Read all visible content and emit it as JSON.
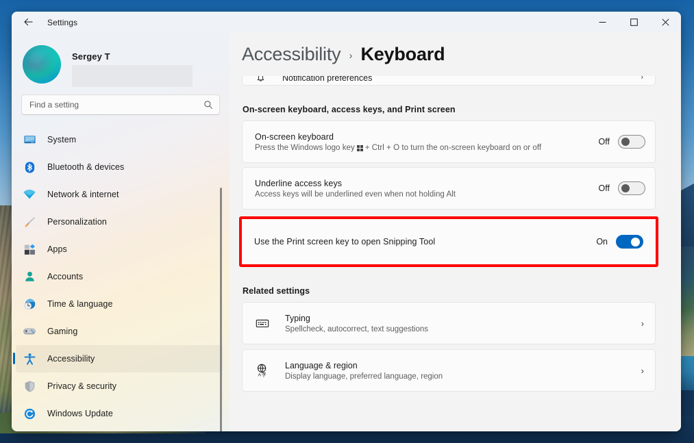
{
  "window": {
    "title": "Settings",
    "back_icon": "arrow-left-icon",
    "controls": {
      "minimize": "–",
      "maximize": "☐",
      "close": "✕"
    }
  },
  "account": {
    "name": "Sergey T",
    "email_redacted": ""
  },
  "search": {
    "placeholder": "Find a setting",
    "value": "",
    "icon": "search-icon"
  },
  "sidebar": {
    "items": [
      {
        "label": "System",
        "icon": "display-icon",
        "selected": false
      },
      {
        "label": "Bluetooth & devices",
        "icon": "bluetooth-icon",
        "selected": false
      },
      {
        "label": "Network & internet",
        "icon": "wifi-icon",
        "selected": false
      },
      {
        "label": "Personalization",
        "icon": "paintbrush-icon",
        "selected": false
      },
      {
        "label": "Apps",
        "icon": "apps-icon",
        "selected": false
      },
      {
        "label": "Accounts",
        "icon": "person-icon",
        "selected": false
      },
      {
        "label": "Time & language",
        "icon": "clock-globe-icon",
        "selected": false
      },
      {
        "label": "Gaming",
        "icon": "gamepad-icon",
        "selected": false
      },
      {
        "label": "Accessibility",
        "icon": "accessibility-icon",
        "selected": true
      },
      {
        "label": "Privacy & security",
        "icon": "shield-icon",
        "selected": false
      },
      {
        "label": "Windows Update",
        "icon": "update-icon",
        "selected": false
      }
    ]
  },
  "header": {
    "breadcrumb_parent": "Accessibility",
    "breadcrumb_separator": "›",
    "breadcrumb_current": "Keyboard"
  },
  "main": {
    "clipped_card": {
      "label": "Notification preferences",
      "icon": "bell-icon",
      "chevron": "›"
    },
    "section_heading": "On-screen keyboard, access keys, and Print screen",
    "settings": [
      {
        "title": "On-screen keyboard",
        "subtitle_before": "Press the Windows logo key",
        "subtitle_after": "+ Ctrl + O to turn the on-screen keyboard on or off",
        "state_label": "Off",
        "state_on": false
      },
      {
        "title": "Underline access keys",
        "subtitle": "Access keys will be underlined even when not holding Alt",
        "state_label": "Off",
        "state_on": false
      }
    ],
    "highlighted_setting": {
      "title": "Use the Print screen key to open Snipping Tool",
      "state_label": "On",
      "state_on": true,
      "highlight_color": "#ff0000"
    },
    "related_heading": "Related settings",
    "related": [
      {
        "title": "Typing",
        "subtitle": "Spellcheck, autocorrect, text suggestions",
        "icon": "keyboard-icon",
        "chevron": "›"
      },
      {
        "title": "Language & region",
        "subtitle": "Display language, preferred language, region",
        "icon": "language-globe-icon",
        "chevron": "›"
      }
    ]
  },
  "colors": {
    "accent": "#0067c0",
    "highlight": "#ff0000",
    "window_bg": "#f3f3f3",
    "card_bg": "#fbfbfb"
  }
}
